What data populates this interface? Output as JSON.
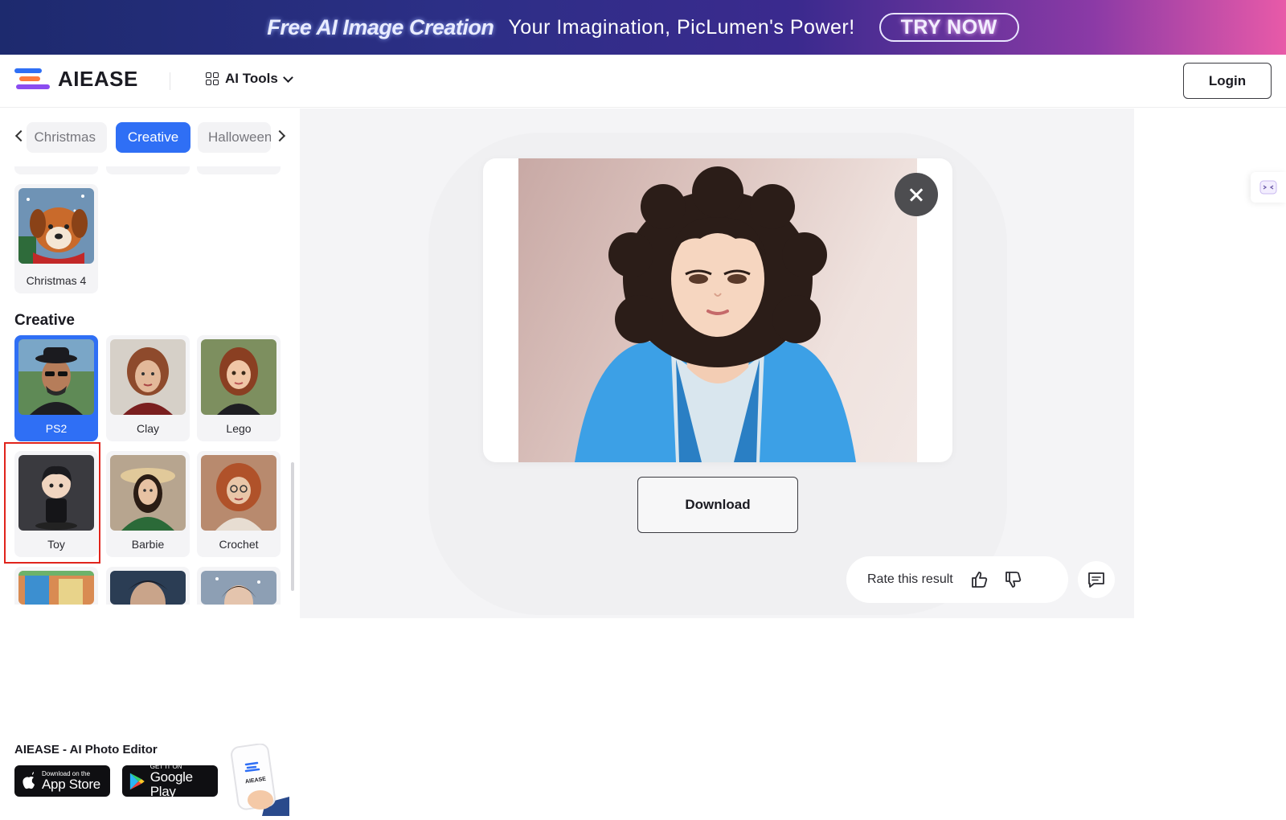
{
  "promo": {
    "title": "Free AI Image Creation",
    "subtitle": "Your Imagination, PicLumen's Power!",
    "button": "TRY NOW"
  },
  "header": {
    "brand": "AIEASE",
    "tools_label": "AI Tools",
    "login_label": "Login"
  },
  "sidebar": {
    "category_tabs": [
      "Christmas",
      "Creative",
      "Halloween"
    ],
    "active_tab": "Creative",
    "previous_group_items": [
      {
        "label": "Christmas 4",
        "icon": "dog-thumbnail"
      }
    ],
    "section_title": "Creative",
    "styles": [
      {
        "label": "PS2",
        "selected": true,
        "icon": "man-with-hat-thumbnail"
      },
      {
        "label": "Clay",
        "icon": "clay-woman-thumbnail"
      },
      {
        "label": "Lego",
        "icon": "lego-woman-thumbnail"
      },
      {
        "label": "Toy",
        "icon": "toy-boy-thumbnail"
      },
      {
        "label": "Barbie",
        "icon": "barbie-thumbnail"
      },
      {
        "label": "Crochet",
        "icon": "crochet-doll-thumbnail"
      }
    ],
    "app_title": "AIEASE - AI Photo Editor",
    "app_store": {
      "small": "Download on the",
      "big": "App Store"
    },
    "google_play": {
      "small": "GET IT ON",
      "big": "Google Play"
    },
    "phone_brand": "AIEASE"
  },
  "result": {
    "download_label": "Download",
    "rate_label": "Rate this result"
  },
  "colors": {
    "accent": "#2f6ff5",
    "selection_outline": "#e0241c"
  }
}
